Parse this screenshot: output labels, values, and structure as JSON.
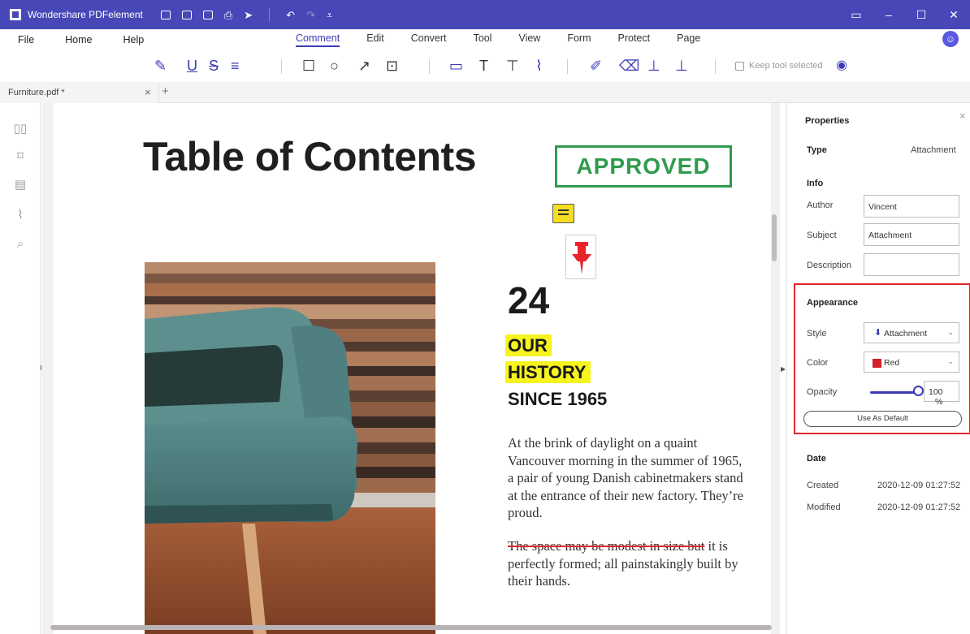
{
  "app": {
    "title": "Wondershare PDFelement",
    "window_controls": [
      "▭",
      "–",
      "☐",
      "✕"
    ]
  },
  "menu": {
    "left": [
      "File",
      "Home",
      "Help"
    ],
    "center": [
      "Comment",
      "Edit",
      "Convert",
      "Tool",
      "View",
      "Form",
      "Protect",
      "Page"
    ],
    "active": "Comment"
  },
  "toolbar": {
    "keep_tool_selected": "Keep tool selected"
  },
  "tabs": {
    "document": "Furniture.pdf *",
    "close": "×",
    "new": "+"
  },
  "document": {
    "heading": "Table of Contents",
    "stamp": "APPROVED",
    "number": "24",
    "highlight_1": "OUR",
    "highlight_2": "HISTORY",
    "subheading": "SINCE 1965",
    "paragraph_1": "At the brink of daylight on a quaint Vancouver morning in the summer of 1965, a pair of young Danish cabinetmakers stand at the entrance of their new factory. They’re proud.",
    "paragraph_2_struck": "The space may be modest in size but",
    "paragraph_2_rest": " it is perfectly formed; all painstakingly built by their hands."
  },
  "properties": {
    "title": "Properties",
    "close": "×",
    "type_label": "Type",
    "type_value": "Attachment",
    "info_label": "Info",
    "author_label": "Author",
    "author_value": "Vincent",
    "subject_label": "Subject",
    "subject_value": "Attachment",
    "description_label": "Description",
    "description_value": "",
    "appearance_label": "Appearance",
    "style_label": "Style",
    "style_value": "Attachment",
    "color_label": "Color",
    "color_value": "Red",
    "color_hex": "#d41f27",
    "opacity_label": "Opacity",
    "opacity_value": "100",
    "opacity_unit": "%",
    "default_button": "Use As Default",
    "date_label": "Date",
    "created_label": "Created",
    "created_value": "2020-12-09 01:27:52",
    "modified_label": "Modified",
    "modified_value": "2020-12-09 01:27:52"
  },
  "colors": {
    "titlebar": "#4747b8",
    "accent": "#3b3bb5",
    "stamp": "#2e9b4e",
    "highlight": "#f6f31f",
    "strike": "#e0262b"
  }
}
